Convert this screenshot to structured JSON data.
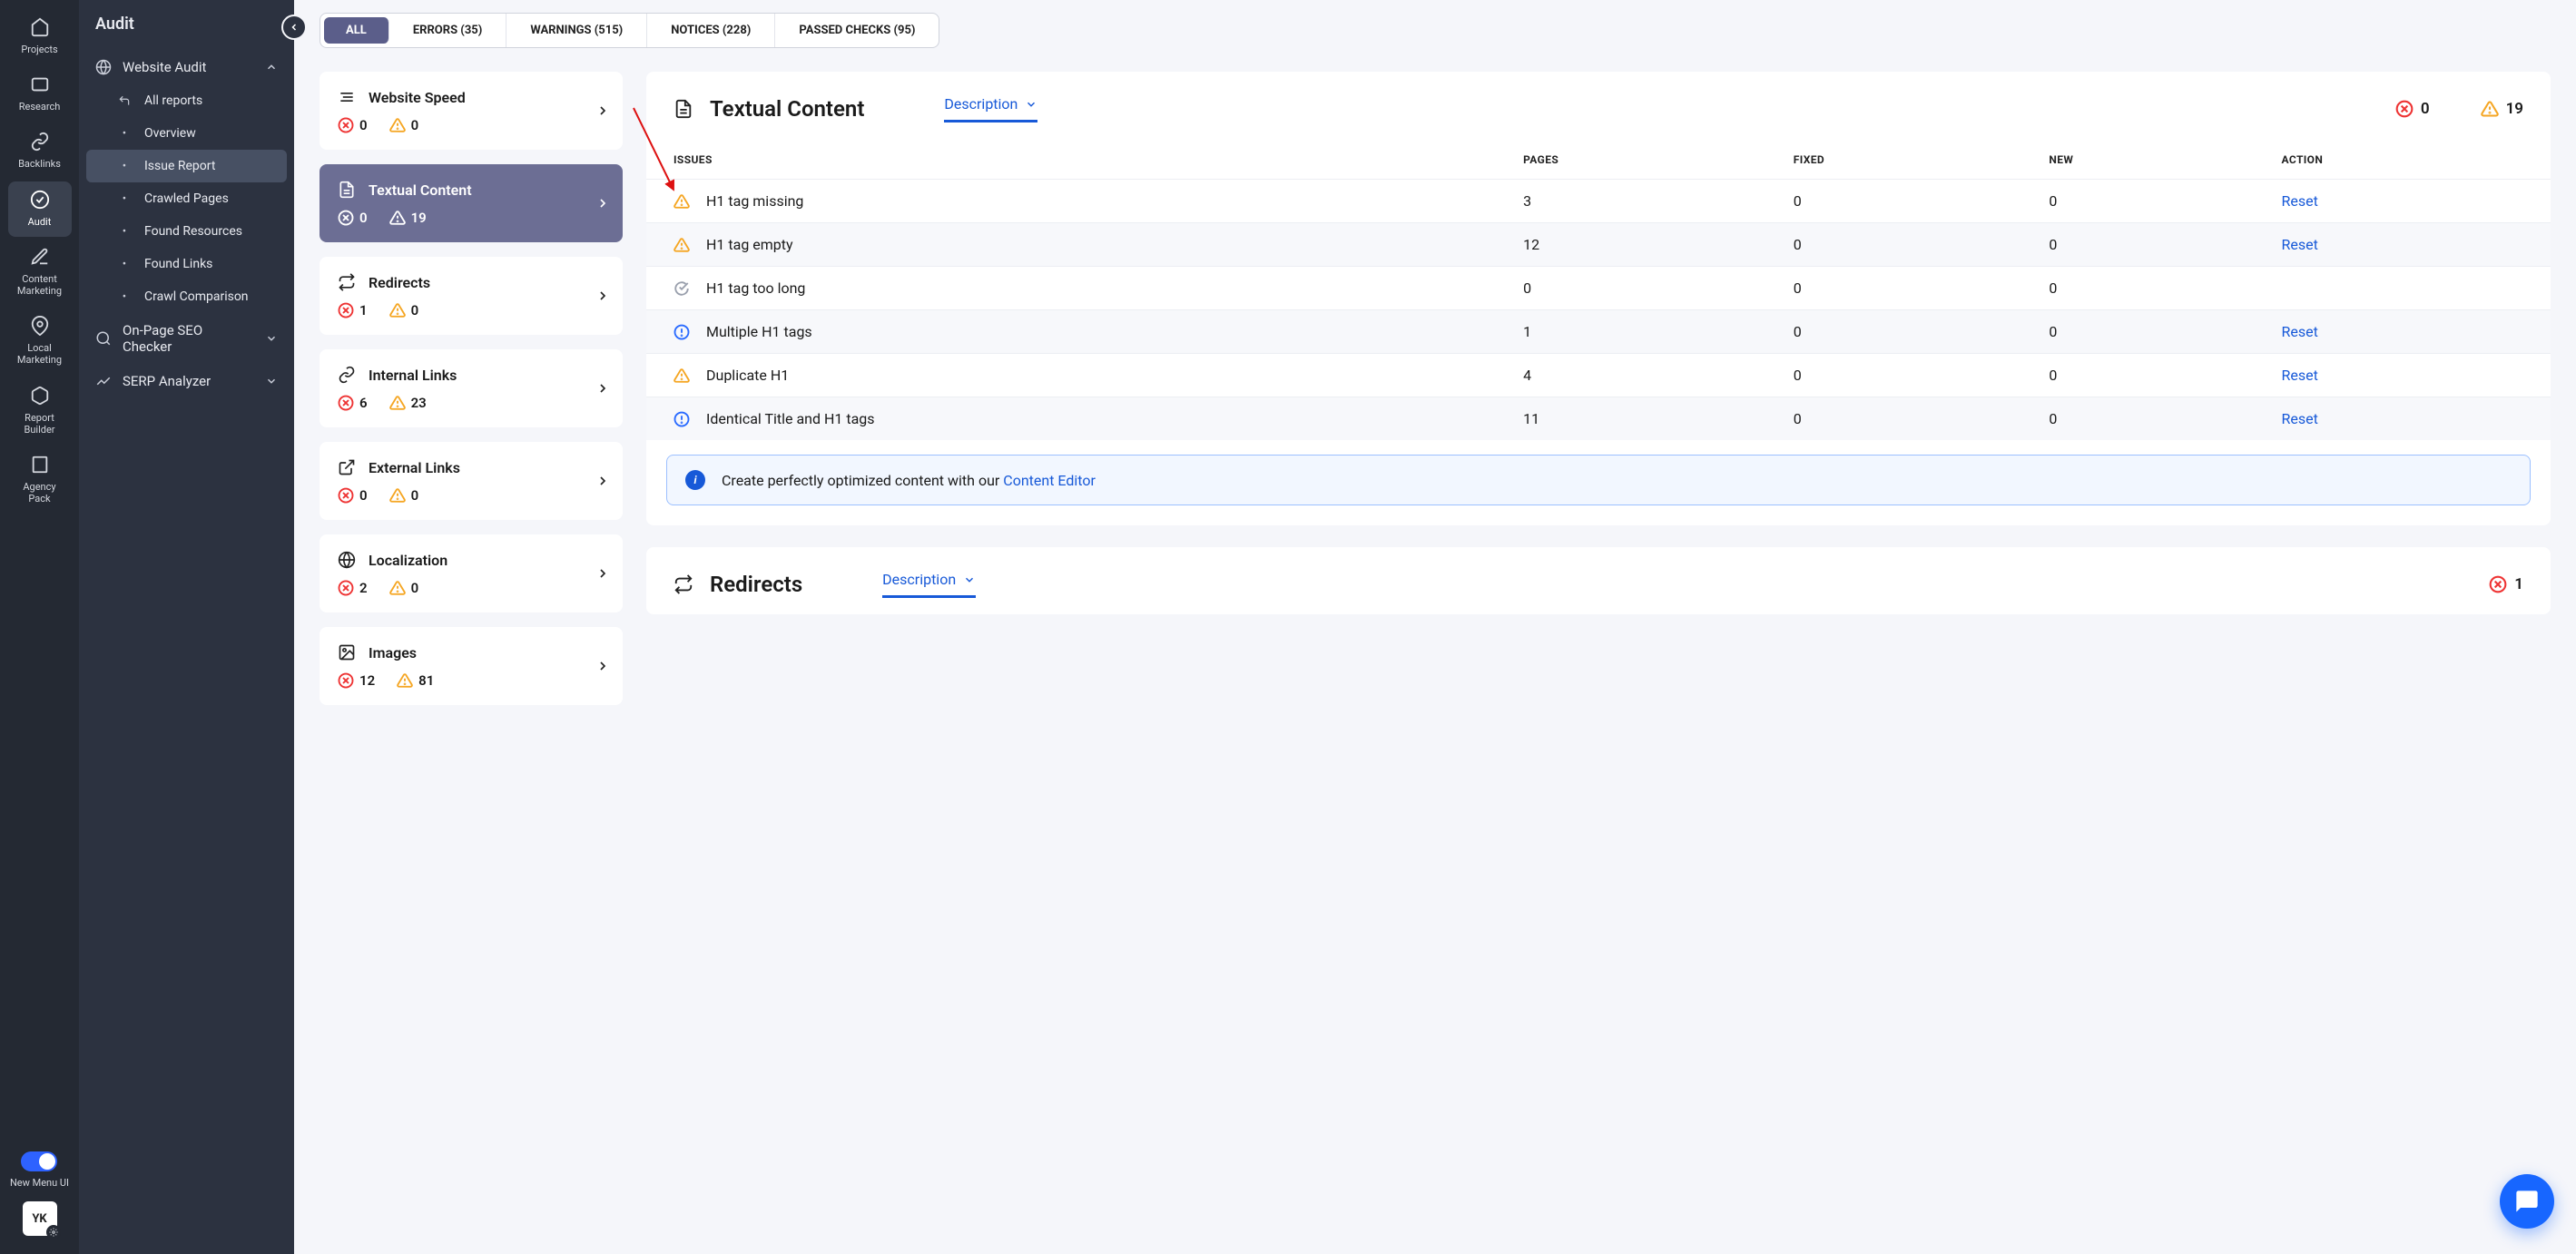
{
  "rail": {
    "items": [
      {
        "name": "projects",
        "label": "Projects"
      },
      {
        "name": "research",
        "label": "Research"
      },
      {
        "name": "backlinks",
        "label": "Backlinks"
      },
      {
        "name": "audit",
        "label": "Audit",
        "active": true
      },
      {
        "name": "content-marketing",
        "label": "Content Marketing"
      },
      {
        "name": "local-marketing",
        "label": "Local Marketing"
      },
      {
        "name": "report-builder",
        "label": "Report Builder"
      },
      {
        "name": "agency-pack",
        "label": "Agency Pack"
      }
    ],
    "toggle_label": "New Menu UI",
    "avatar": "YK"
  },
  "sidebar": {
    "title": "Audit",
    "groups": [
      {
        "label": "Website Audit",
        "expanded": true,
        "items": [
          {
            "label": "All reports",
            "icon": "back-arrow"
          },
          {
            "label": "Overview"
          },
          {
            "label": "Issue Report",
            "active": true
          },
          {
            "label": "Crawled Pages"
          },
          {
            "label": "Found Resources"
          },
          {
            "label": "Found Links"
          },
          {
            "label": "Crawl Comparison"
          }
        ]
      },
      {
        "label": "On-Page SEO Checker",
        "expanded": false
      },
      {
        "label": "SERP Analyzer",
        "expanded": false
      }
    ]
  },
  "filters": [
    {
      "label": "ALL",
      "active": true
    },
    {
      "label": "ERRORS (35)"
    },
    {
      "label": "WARNINGS (515)"
    },
    {
      "label": "NOTICES (228)"
    },
    {
      "label": "PASSED CHECKS (95)"
    }
  ],
  "categories": [
    {
      "id": "website-speed",
      "label": "Website Speed",
      "errors": 0,
      "warnings": 0
    },
    {
      "id": "textual-content",
      "label": "Textual Content",
      "errors": 0,
      "warnings": 19,
      "selected": true
    },
    {
      "id": "redirects",
      "label": "Redirects",
      "errors": 1,
      "warnings": 0
    },
    {
      "id": "internal-links",
      "label": "Internal Links",
      "errors": 6,
      "warnings": 23
    },
    {
      "id": "external-links",
      "label": "External Links",
      "errors": 0,
      "warnings": 0
    },
    {
      "id": "localization",
      "label": "Localization",
      "errors": 2,
      "warnings": 0
    },
    {
      "id": "images",
      "label": "Images",
      "errors": 12,
      "warnings": 81
    }
  ],
  "detail": {
    "title": "Textual Content",
    "tab": "Description",
    "errors": 0,
    "warnings": 19,
    "columns": [
      "ISSUES",
      "PAGES",
      "FIXED",
      "NEW",
      "ACTION"
    ],
    "rows": [
      {
        "icon": "warning",
        "issue": "H1 tag missing",
        "pages": 3,
        "fixed": 0,
        "new": 0,
        "action": "Reset"
      },
      {
        "icon": "warning",
        "issue": "H1 tag empty",
        "pages": 12,
        "fixed": 0,
        "new": 0,
        "action": "Reset"
      },
      {
        "icon": "check",
        "issue": "H1 tag too long",
        "pages": 0,
        "fixed": 0,
        "new": 0,
        "action": ""
      },
      {
        "icon": "notice",
        "issue": "Multiple H1 tags",
        "pages": 1,
        "fixed": 0,
        "new": 0,
        "action": "Reset"
      },
      {
        "icon": "warning",
        "issue": "Duplicate H1",
        "pages": 4,
        "fixed": 0,
        "new": 0,
        "action": "Reset"
      },
      {
        "icon": "notice",
        "issue": "Identical Title and H1 tags",
        "pages": 11,
        "fixed": 0,
        "new": 0,
        "action": "Reset"
      }
    ],
    "banner_text": "Create perfectly optimized content with our ",
    "banner_link": "Content Editor"
  },
  "detail2": {
    "title": "Redirects",
    "tab": "Description",
    "errors": 1
  }
}
